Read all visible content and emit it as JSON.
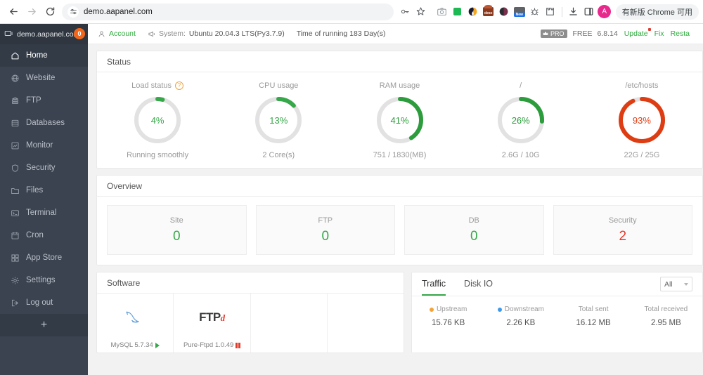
{
  "browser": {
    "back_icon": "back-arrow-icon",
    "forward_icon": "forward-arrow-icon",
    "reload_icon": "reload-icon",
    "site_settings_icon": "tune-sliders-icon",
    "url": "demo.aapanel.com",
    "bookmark_icon": "star-icon",
    "password_icon": "key-icon",
    "extensions": [
      "camera-icon",
      "green-flag-icon",
      "orange-swirl-icon",
      "desc-badge-icon",
      "dark-circle-icon",
      "new-badge-icon",
      "bug-icon",
      "puzzle-icon"
    ],
    "download_icon": "download-icon",
    "sidepanel_icon": "side-panel-icon",
    "avatar_letter": "A",
    "update_pill": "有新版 Chrome 可用"
  },
  "sidebar": {
    "host": "demo.aapanel.com",
    "badge": "0",
    "host_icon": "monitor-icon",
    "add_label": "+",
    "items": [
      {
        "label": "Home",
        "icon": "home-icon",
        "active": true
      },
      {
        "label": "Website",
        "icon": "globe-icon",
        "active": false
      },
      {
        "label": "FTP",
        "icon": "server-icon",
        "active": false
      },
      {
        "label": "Databases",
        "icon": "database-icon",
        "active": false
      },
      {
        "label": "Monitor",
        "icon": "chart-icon",
        "active": false
      },
      {
        "label": "Security",
        "icon": "shield-icon",
        "active": false
      },
      {
        "label": "Files",
        "icon": "folder-icon",
        "active": false
      },
      {
        "label": "Terminal",
        "icon": "terminal-icon",
        "active": false
      },
      {
        "label": "Cron",
        "icon": "calendar-icon",
        "active": false
      },
      {
        "label": "App Store",
        "icon": "grid-icon",
        "active": false
      },
      {
        "label": "Settings",
        "icon": "gear-icon",
        "active": false
      },
      {
        "label": "Log out",
        "icon": "logout-icon",
        "active": false
      }
    ]
  },
  "topbar": {
    "account_label": "Account",
    "account_icon": "user-icon",
    "system_icon": "megaphone-icon",
    "system_label": "System:",
    "system_value": "Ubuntu 20.04.3 LTS(Py3.7.9)",
    "uptime": "Time of running 183 Day(s)",
    "pro_badge": "PRO",
    "pro_icon": "crown-icon",
    "license": "FREE",
    "version": "6.8.14",
    "update_link": "Update",
    "fix_link": "Fix",
    "restart_link": "Resta"
  },
  "status": {
    "title": "Status",
    "help_icon": "question-mark-icon",
    "gauges": [
      {
        "title": "Load status",
        "percent": 4,
        "display": "4%",
        "sub": "Running smoothly",
        "color": "#36a84a",
        "has_help": true
      },
      {
        "title": "CPU usage",
        "percent": 13,
        "display": "13%",
        "sub": "2 Core(s)",
        "color": "#36a84a",
        "has_help": false
      },
      {
        "title": "RAM usage",
        "percent": 41,
        "display": "41%",
        "sub": "751 / 1830(MB)",
        "color": "#2c9c3c",
        "has_help": false
      },
      {
        "title": "/",
        "percent": 26,
        "display": "26%",
        "sub": "2.6G / 10G",
        "color": "#2c9c3c",
        "has_help": false
      },
      {
        "title": "/etc/hosts",
        "percent": 93,
        "display": "93%",
        "sub": "22G / 25G",
        "color": "#de3c12",
        "has_help": false
      }
    ]
  },
  "overview": {
    "title": "Overview",
    "cards": [
      {
        "label": "Site",
        "value": "0",
        "color": "#36a84a"
      },
      {
        "label": "FTP",
        "value": "0",
        "color": "#36a84a"
      },
      {
        "label": "DB",
        "value": "0",
        "color": "#36a84a"
      },
      {
        "label": "Security",
        "value": "2",
        "color": "#e23b2e"
      }
    ]
  },
  "software": {
    "title": "Software",
    "items": [
      {
        "name": "MySQL 5.7.34",
        "logo": "mysql-dolphin-icon",
        "state": "running"
      },
      {
        "name": "Pure-Ftpd 1.0.49",
        "logo": "ftp-logo-icon",
        "state": "stopped"
      },
      {
        "name": "",
        "logo": "",
        "state": ""
      },
      {
        "name": "",
        "logo": "",
        "state": ""
      }
    ]
  },
  "traffic": {
    "tabs": [
      {
        "label": "Traffic",
        "active": true
      },
      {
        "label": "Disk IO",
        "active": false
      }
    ],
    "range_select": "All",
    "stats": [
      {
        "label": "Upstream",
        "value": "15.76 KB",
        "dot": "#f0a43a"
      },
      {
        "label": "Downstream",
        "value": "2.26 KB",
        "dot": "#3e9ae8"
      },
      {
        "label": "Total sent",
        "value": "16.12 MB",
        "dot": ""
      },
      {
        "label": "Total received",
        "value": "2.95 MB",
        "dot": ""
      }
    ]
  }
}
